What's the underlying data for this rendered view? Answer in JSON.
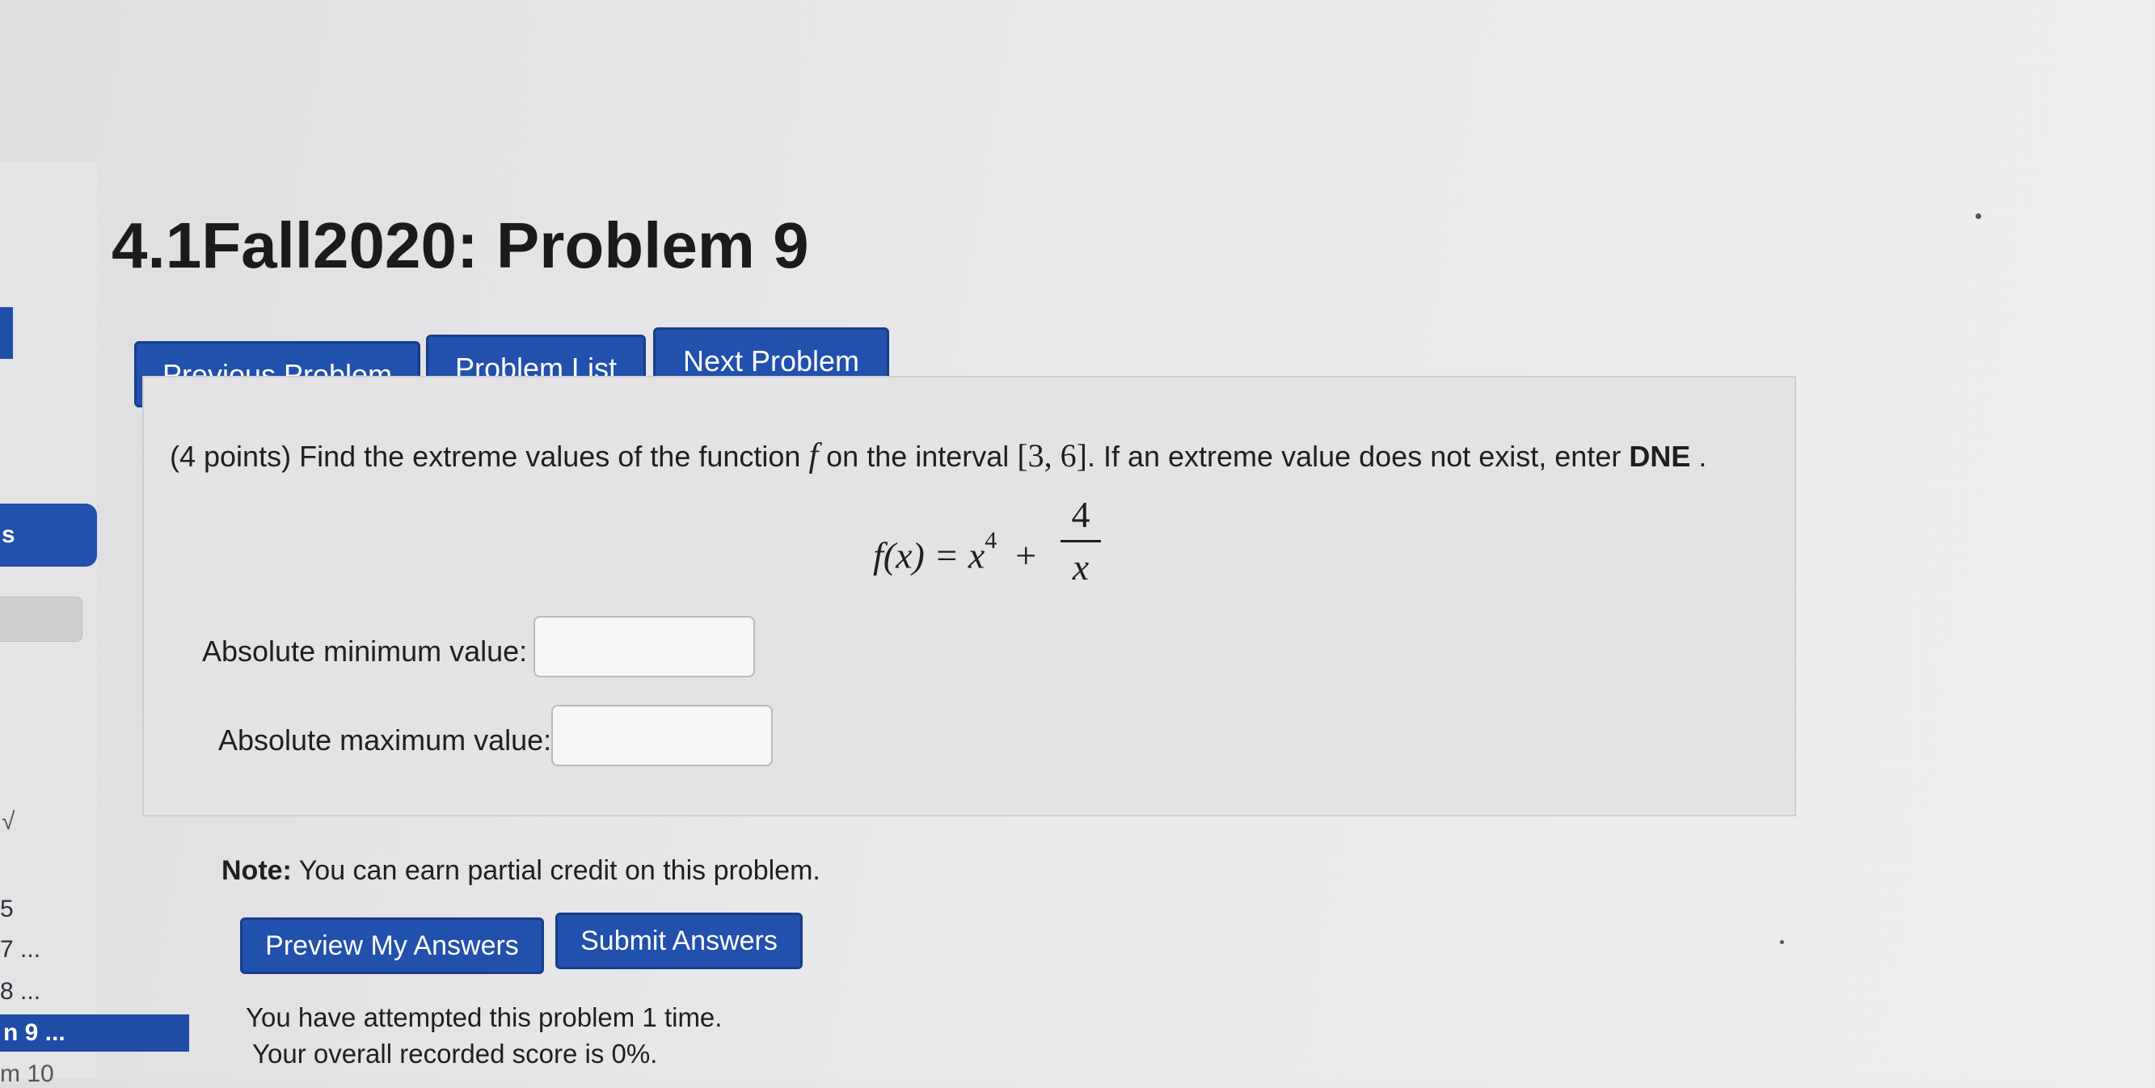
{
  "page": {
    "title": "4.1Fall2020: Problem 9"
  },
  "nav": {
    "previous_label": "Previous Problem",
    "list_label": "Problem List",
    "next_label": "Next Problem"
  },
  "sidebar": {
    "pill_label": "s",
    "items": [
      "7 ...",
      "8 ...",
      "n 9 ...",
      "m 10"
    ],
    "check_mark": "√",
    "partial_number": "5"
  },
  "problem": {
    "points": "(4 points)",
    "prompt_a": "Find the extreme values of the function",
    "func_name": "f",
    "prompt_b": "on the interval",
    "interval": "[3, 6]",
    "prompt_c": ". If an extreme value does not exist, enter",
    "dne": "DNE",
    "prompt_end": ".",
    "equation_left": "f(x) = x",
    "equation_exp": "4",
    "equation_plus": "+",
    "frac_num": "4",
    "frac_den": "x"
  },
  "answers": {
    "min_label": "Absolute minimum value:",
    "min_value": "",
    "max_label": "Absolute maximum value:",
    "max_value": ""
  },
  "note": {
    "label": "Note:",
    "text": "You can earn partial credit on this problem."
  },
  "actions": {
    "preview_label": "Preview My Answers",
    "submit_label": "Submit Answers"
  },
  "status": {
    "attempts": "You have attempted this problem 1 time.",
    "score": "Your overall recorded score is 0%."
  },
  "colors": {
    "button_blue": "#2150ad",
    "button_border": "#173d8a",
    "panel_bg": "#e3e3e5"
  }
}
